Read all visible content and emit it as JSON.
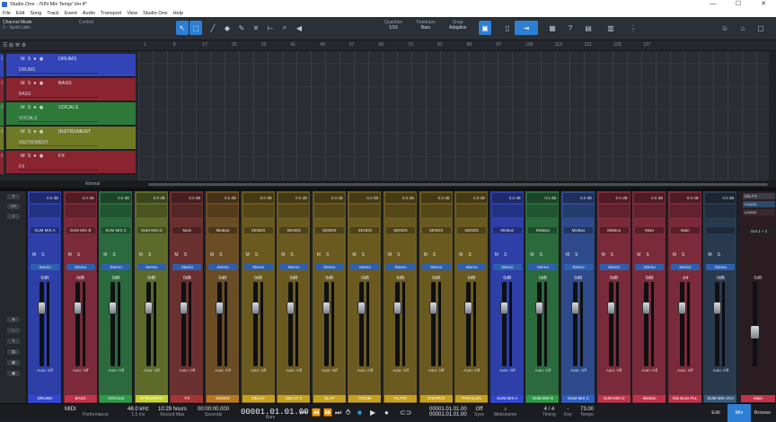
{
  "window": {
    "title": "Studio One - /SIN Mix Temp/ Ver.4*"
  },
  "menu": [
    "File",
    "Edit",
    "Song",
    "Track",
    "Event",
    "Audio",
    "Transport",
    "View",
    "Studio One",
    "Help"
  ],
  "toolbar": {
    "channel_mode": "Channel Mode",
    "channel_sub": "2 - Spotl.Lider",
    "control": "Control",
    "quantize_label": "Quantize",
    "quantize_val": "1/16",
    "timebase_label": "Timebase",
    "timebase_val": "Bars",
    "snap_label": "Snap",
    "snap_val": "Adaptive"
  },
  "ruler": [
    "1",
    "9",
    "17",
    "25",
    "33",
    "41",
    "49",
    "57",
    "65",
    "73",
    "81",
    "89",
    "97",
    "105",
    "113",
    "121",
    "129",
    "137"
  ],
  "tracks": [
    {
      "num": "1",
      "name": "DRUMS",
      "sub": "DRUMS",
      "color": "#3344b8"
    },
    {
      "num": "2",
      "name": "BASS",
      "sub": "BASS",
      "color": "#8a2530"
    },
    {
      "num": "3",
      "name": "VOCALS",
      "sub": "VOCALS",
      "color": "#2d7a3a"
    },
    {
      "num": "4",
      "name": "INSTRUMENT",
      "sub": "INSTRUMENT",
      "color": "#707a25"
    },
    {
      "num": "5",
      "name": "FX",
      "sub": "FX",
      "color": "#8a2530"
    }
  ],
  "normal": "Normal",
  "strips": [
    {
      "name": "DRUMS",
      "out": "SUM MIX A",
      "color": "#2e3fa8",
      "label_bg": "#3347d0",
      "gain": "0dB",
      "knob": 0.72
    },
    {
      "name": "BASS",
      "out": "SUM MIX B",
      "color": "#7a2a3a",
      "label_bg": "#c0334a",
      "gain": "0dB",
      "knob": 0.72
    },
    {
      "name": "VOCALS",
      "out": "SUM MIX C",
      "color": "#2a6a3c",
      "label_bg": "#2d9a45",
      "gain": "0dB",
      "knob": 0.72
    },
    {
      "name": "INTRUMENT",
      "out": "SUM MIX D",
      "color": "#5e6a2a",
      "label_bg": "#c7d22a",
      "gain": "0dB",
      "knob": 0.72
    },
    {
      "name": "FX",
      "out": "Main",
      "color": "#6a3030",
      "label_bg": "#a83434",
      "gain": "0dB",
      "knob": 0.72
    },
    {
      "name": "SENDS",
      "out": "MixBus",
      "color": "#6a4c25",
      "label_bg": "#b87a20",
      "gain": "0dB",
      "knob": 0.72
    },
    {
      "name": "DELAY",
      "out": "SENDS",
      "color": "#6a5a20",
      "label_bg": "#c8a020",
      "gain": "0dB",
      "knob": 0.72
    },
    {
      "name": "DELAY 2",
      "out": "SENDS",
      "color": "#6a5a20",
      "label_bg": "#c8a020",
      "gain": "0dB",
      "knob": 0.72
    },
    {
      "name": "SLAP",
      "out": "SENDS",
      "color": "#6a5a20",
      "label_bg": "#c8a020",
      "gain": "0dB",
      "knob": 0.72
    },
    {
      "name": "ROOM",
      "out": "SENDS",
      "color": "#6a5a20",
      "label_bg": "#c8a020",
      "gain": "0dB",
      "knob": 0.72
    },
    {
      "name": "PLATE",
      "out": "SENDS",
      "color": "#6a5a20",
      "label_bg": "#c8a020",
      "gain": "0dB",
      "knob": 0.72
    },
    {
      "name": "CHORUS",
      "out": "SENDS",
      "color": "#6a5a20",
      "label_bg": "#c8a020",
      "gain": "0dB",
      "knob": 0.72
    },
    {
      "name": "PARALLEL",
      "out": "SENDS",
      "color": "#6a5a20",
      "label_bg": "#c8a020",
      "gain": "0dB",
      "knob": 0.72
    },
    {
      "name": "SUM MIX A",
      "out": "MixBus",
      "color": "#2e3fa8",
      "label_bg": "#3347d0",
      "gain": "0dB",
      "knob": 0.72
    },
    {
      "name": "SUM MIX B",
      "out": "MixBus",
      "color": "#2a6a3c",
      "label_bg": "#2d9a45",
      "gain": "0dB",
      "knob": 0.72
    },
    {
      "name": "SUM MIX C",
      "out": "MixBus",
      "color": "#2e4a8a",
      "label_bg": "#2d5fc0",
      "gain": "0dB",
      "knob": 0.72
    },
    {
      "name": "SUM MIX D",
      "out": "MixBus",
      "color": "#7a2a3a",
      "label_bg": "#c0334a",
      "gain": "0dB",
      "knob": 0.72
    },
    {
      "name": "MixBus",
      "out": "Main",
      "color": "#7a2a3a",
      "label_bg": "#c0334a",
      "gain": "0dB",
      "knob": 0.72
    },
    {
      "name": "Mix Buss PLL",
      "out": "Main",
      "color": "#7a2a3a",
      "label_bg": "#c0334a",
      "gain": "-inf",
      "knob": 0.72
    },
    {
      "name": "SUM MIX VCA",
      "out": "",
      "color": "#2a3a4e",
      "label_bg": "#3a5a7a",
      "gain": "0dB",
      "knob": 0.72
    }
  ],
  "main": {
    "name": "Main",
    "output": "Out 1 + 2",
    "mixfx": "Mix FX",
    "inserts": "Inserts",
    "limiter": "Limiter",
    "gain": "0dB"
  },
  "transport": {
    "midi": "MIDI",
    "performance": "Performance",
    "samplerate": "48.0 kHz",
    "latency": "1.5 ms",
    "record_max": "10:29 hours",
    "record_label": "Record Max",
    "time_primary": "00:00:00.000",
    "time_primary_label": "Seconds",
    "bars": "00001.01.01.00",
    "bars_label": "Bars",
    "loop_l": "00001.01.01.00",
    "loop_r": "00001.01.01.00",
    "off": "Off",
    "sync": "Sync",
    "metronome": "Metronome",
    "timing": "4 / 4",
    "timing_label": "Timing",
    "key_label": "Key",
    "tempo": "73.00",
    "tempo_label": "Tempo",
    "edit": "Edit",
    "mix": "Mix",
    "browse": "Browse"
  }
}
